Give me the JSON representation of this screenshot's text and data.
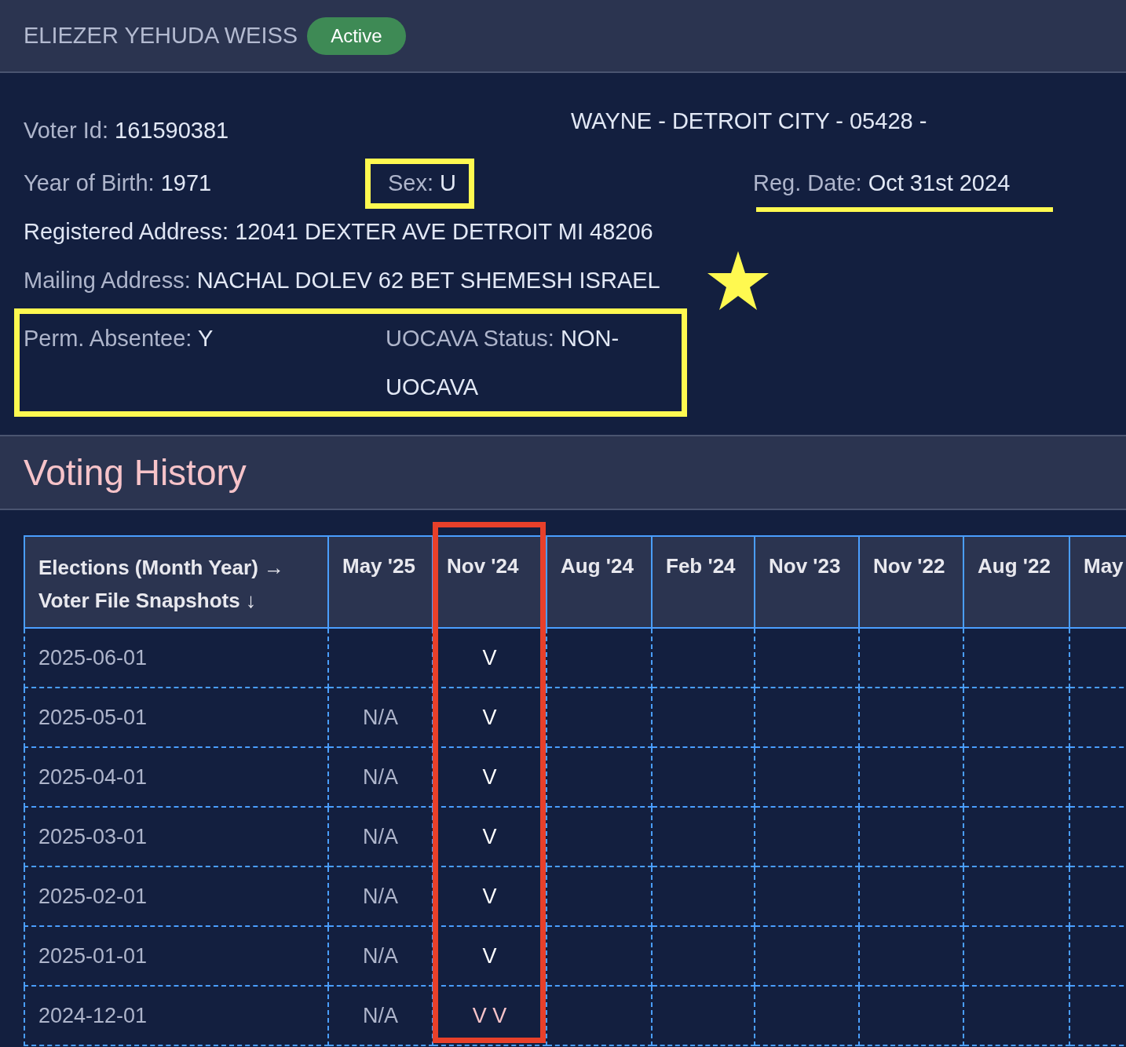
{
  "voter": {
    "name": "ELIEZER YEHUDA WEISS",
    "status": "Active"
  },
  "location": "WAYNE - DETROIT CITY - 05428 -",
  "voter_id": {
    "label": "Voter Id:",
    "value": "161590381"
  },
  "year_of_birth": {
    "label": "Year of Birth:",
    "value": "1971"
  },
  "sex": {
    "label": "Sex:",
    "value": "U"
  },
  "reg_date": {
    "label": "Reg. Date:",
    "value": "Oct 31st 2024"
  },
  "registered_address": {
    "label": "Registered Address:",
    "value": "12041 DEXTER AVE DETROIT MI 48206"
  },
  "mailing_address": {
    "label": "Mailing Address:",
    "value": "NACHAL DOLEV 62 BET SHEMESH ISRAEL"
  },
  "perm_absentee": {
    "label": "Perm. Absentee:",
    "value": "Y"
  },
  "uocava": {
    "label": "UOCAVA Status:",
    "value": "NON-UOCAVA"
  },
  "history": {
    "title": "Voting History",
    "corner": [
      "Elections (Month Year) →",
      "Voter File Snapshots ↓"
    ],
    "columns": [
      "May '25",
      "Nov '24",
      "Aug '24",
      "Feb '24",
      "Nov '23",
      "Nov '22",
      "Aug '22",
      "May"
    ],
    "rows": [
      {
        "snapshot": "2025-06-01",
        "cells": [
          {
            "kind": "blank"
          },
          {
            "text": "V",
            "kind": "vote"
          }
        ]
      },
      {
        "snapshot": "2025-05-01",
        "cells": [
          {
            "text": "N/A",
            "kind": "na"
          },
          {
            "text": "V",
            "kind": "vote"
          }
        ]
      },
      {
        "snapshot": "2025-04-01",
        "cells": [
          {
            "text": "N/A",
            "kind": "na"
          },
          {
            "text": "V",
            "kind": "vote"
          }
        ]
      },
      {
        "snapshot": "2025-03-01",
        "cells": [
          {
            "text": "N/A",
            "kind": "na"
          },
          {
            "text": "V",
            "kind": "vote"
          }
        ]
      },
      {
        "snapshot": "2025-02-01",
        "cells": [
          {
            "text": "N/A",
            "kind": "na"
          },
          {
            "text": "V",
            "kind": "vote"
          }
        ]
      },
      {
        "snapshot": "2025-01-01",
        "cells": [
          {
            "text": "N/A",
            "kind": "na"
          },
          {
            "text": "V",
            "kind": "vote"
          }
        ]
      },
      {
        "snapshot": "2024-12-01",
        "cells": [
          {
            "text": "N/A",
            "kind": "na"
          },
          {
            "text": "V V",
            "kind": "flagged"
          }
        ]
      }
    ]
  }
}
